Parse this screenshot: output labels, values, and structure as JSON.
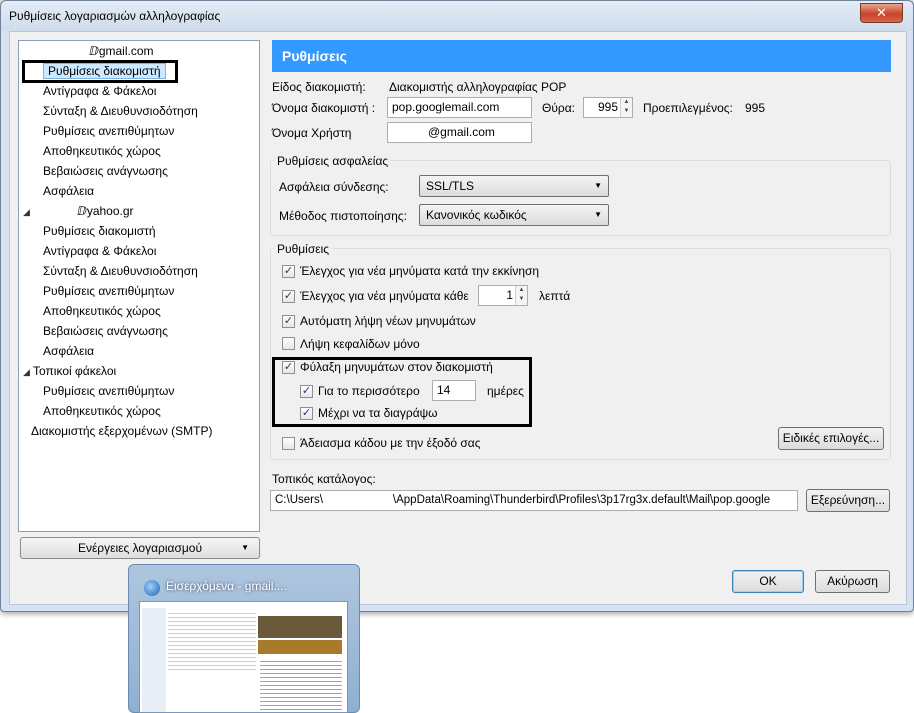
{
  "window": {
    "title": "Ρυθμίσεις λογαριασμών αλληλογραφίας",
    "close_label": "✕"
  },
  "tree": {
    "items": [
      {
        "label": "⁠ⅅgmail.com",
        "level": 0,
        "expand": "",
        "id": "gmail-account"
      },
      {
        "label": "Ρυθμίσεις διακομιστή",
        "level": 1,
        "expand": "",
        "id": "server-settings-1"
      },
      {
        "label": "Αντίγραφα & Φάκελοι",
        "level": 1,
        "expand": "",
        "id": "copies-folders-1"
      },
      {
        "label": "Σύνταξη & Διευθυνσιοδότηση",
        "level": 1,
        "expand": "",
        "id": "composition-1"
      },
      {
        "label": "Ρυθμίσεις ανεπιθύμητων",
        "level": 1,
        "expand": "",
        "id": "junk-1"
      },
      {
        "label": "Αποθηκευτικός χώρος",
        "level": 1,
        "expand": "",
        "id": "disk-space-1"
      },
      {
        "label": "Βεβαιώσεις ανάγνωσης",
        "level": 1,
        "expand": "",
        "id": "receipts-1"
      },
      {
        "label": "Ασφάλεια",
        "level": 1,
        "expand": "",
        "id": "security-1"
      },
      {
        "label": "ⅅyahoo.gr",
        "level": 0,
        "expand": "◢",
        "id": "yahoo-account"
      },
      {
        "label": "Ρυθμίσεις διακομιστή",
        "level": 1,
        "expand": "",
        "id": "server-settings-2"
      },
      {
        "label": "Αντίγραφα & Φάκελοι",
        "level": 1,
        "expand": "",
        "id": "copies-folders-2"
      },
      {
        "label": "Σύνταξη & Διευθυνσιοδότηση",
        "level": 1,
        "expand": "",
        "id": "composition-2"
      },
      {
        "label": "Ρυθμίσεις ανεπιθύμητων",
        "level": 1,
        "expand": "",
        "id": "junk-2"
      },
      {
        "label": "Αποθηκευτικός χώρος",
        "level": 1,
        "expand": "",
        "id": "disk-space-2"
      },
      {
        "label": "Βεβαιώσεις ανάγνωσης",
        "level": 1,
        "expand": "",
        "id": "receipts-2"
      },
      {
        "label": "Ασφάλεια",
        "level": 1,
        "expand": "",
        "id": "security-2"
      },
      {
        "label": "Τοπικοί φάκελοι",
        "level": 0,
        "expand": "◢",
        "id": "local-folders"
      },
      {
        "label": "Ρυθμίσεις ανεπιθύμητων",
        "level": 1,
        "expand": "",
        "id": "junk-3"
      },
      {
        "label": "Αποθηκευτικός χώρος",
        "level": 1,
        "expand": "",
        "id": "disk-space-3"
      },
      {
        "label": "Διακομιστής εξερχομένων (SMTP)",
        "level": 0,
        "expand": "",
        "id": "smtp"
      }
    ],
    "selected_index": 1
  },
  "account_actions_label": "Ενέργειες λογαριασμού",
  "header": {
    "title": "Ρυθμίσεις"
  },
  "server": {
    "type_label": "Είδος διακομιστή:",
    "type_value": "Διακομιστής αλληλογραφίας POP",
    "name_label": "Όνομα διακομιστή :",
    "name_value": "pop.googlemail.com",
    "port_label": "Θύρα:",
    "port_value": "995",
    "default_label": "Προεπιλεγμένος:",
    "default_value": "995",
    "user_label": "Όνομα Χρήστη",
    "user_value": "@gmail.com"
  },
  "security": {
    "group_title": "Ρυθμίσεις ασφαλείας",
    "conn_label": "Ασφάλεια σύνδεσης:",
    "conn_value": "SSL/TLS",
    "auth_label": "Μέθοδος πιστοποίησης:",
    "auth_value": "Κανονικός κωδικός"
  },
  "settings": {
    "group_title": "Ρυθμίσεις",
    "check_startup": "Έλεγχος για νέα μηνύματα κατά την εκκίνηση",
    "check_every": "Έλεγχος για νέα μηνύματα κάθε",
    "check_every_value": "1",
    "minutes": "λεπτά",
    "auto_download": "Αυτόματη λήψη νέων μηνυμάτων",
    "headers_only": "Λήψη κεφαλίδων μόνο",
    "leave_on_server": "Φύλαξη μηνυμάτων στον διακομιστή",
    "for_at_most": "Για το περισσότερο",
    "days_value": "14",
    "days": "ημέρες",
    "until_delete": "Μέχρι να τα διαγράψω",
    "empty_trash": "Άδειασμα κάδου με την έξοδό σας",
    "advanced_button": "Ειδικές επιλογές...",
    "states": {
      "check_startup": true,
      "check_every": true,
      "auto_download": true,
      "headers_only": false,
      "leave_on_server": true,
      "for_at_most": true,
      "until_delete": true,
      "empty_trash": false
    }
  },
  "local_dir": {
    "label": "Τοπικός κατάλογος:",
    "path_prefix": "C:\\Users\\",
    "path_suffix": "\\AppData\\Roaming\\Thunderbird\\Profiles\\3p17rg3x.default\\Mail\\pop.google",
    "browse_button": "Εξερεύνηση..."
  },
  "buttons": {
    "ok": "OK",
    "cancel": "Ακύρωση"
  },
  "taskbar_preview": {
    "title": "Εισερχόμενα -            gmail...."
  }
}
